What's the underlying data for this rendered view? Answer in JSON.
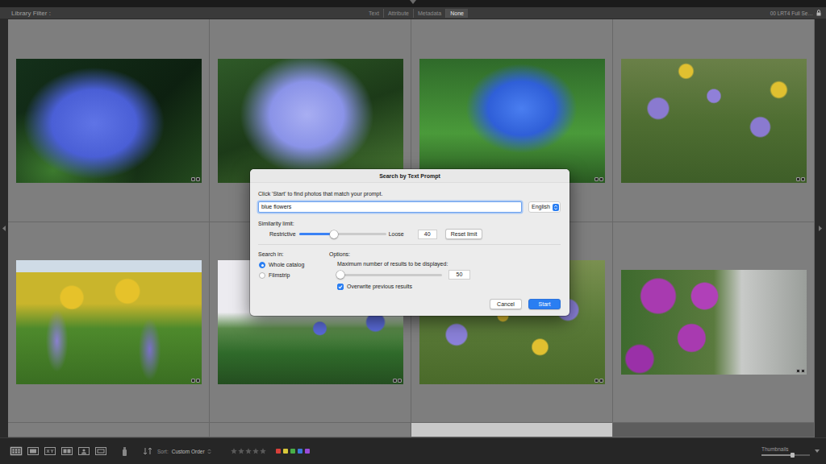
{
  "filter_bar": {
    "title": "Library Filter :",
    "tabs": [
      {
        "label": "Text",
        "selected": false
      },
      {
        "label": "Attribute",
        "selected": false
      },
      {
        "label": "Metadata",
        "selected": false
      },
      {
        "label": "None",
        "selected": true
      }
    ],
    "preset": "00 LRT4 Full Se…"
  },
  "grid": {
    "cells": [
      {
        "kind": "photo",
        "selected": false
      },
      {
        "kind": "photo",
        "selected": false
      },
      {
        "kind": "photo",
        "selected": false
      },
      {
        "kind": "photo",
        "selected": false
      },
      {
        "kind": "photo",
        "selected": false
      },
      {
        "kind": "photo",
        "selected": false
      },
      {
        "kind": "photo",
        "selected": false
      },
      {
        "kind": "photo",
        "selected": false
      },
      {
        "kind": "partial",
        "selected": false
      },
      {
        "kind": "partial",
        "selected": false
      },
      {
        "kind": "partial",
        "selected": true
      },
      {
        "kind": "empty",
        "selected": false
      }
    ]
  },
  "dialog": {
    "title": "Search by Text Prompt",
    "instruction": "Click 'Start' to find photos that match your prompt.",
    "prompt": "blue flowers",
    "language": "English",
    "similarity": {
      "label": "Similarity limit:",
      "min_label": "Restrictive",
      "max_label": "Loose",
      "level": 0.4,
      "value": "40",
      "reset": "Reset limit"
    },
    "search_in": {
      "label": "Search in:",
      "options": [
        {
          "label": "Whole catalog",
          "selected": true
        },
        {
          "label": "Filmstrip",
          "selected": false
        }
      ]
    },
    "options": {
      "label": "Options:",
      "max_results": {
        "label": "Maximum number of results to be displayed:",
        "level": 0.03,
        "value": "50"
      },
      "overwrite": {
        "label": "Overwrite previous results",
        "checked": true
      }
    },
    "buttons": [
      {
        "label": "Cancel",
        "primary": false
      },
      {
        "label": "Start",
        "primary": true
      }
    ]
  },
  "toolbar": {
    "view_modes": [
      {
        "selected": true
      },
      {
        "selected": false
      },
      {
        "selected": false
      },
      {
        "selected": false
      },
      {
        "selected": false
      },
      {
        "selected": false
      }
    ],
    "sort": {
      "label": "Sort:",
      "value": "Custom Order"
    },
    "rating": {
      "stars": 0
    },
    "color_labels": [
      {
        "color": "#d8403a"
      },
      {
        "color": "#d8c83a"
      },
      {
        "color": "#48ae48"
      },
      {
        "color": "#3a78d8"
      },
      {
        "color": "#9a4ad8"
      }
    ],
    "thumbnails": {
      "label": "Thumbnails",
      "level": 0.63
    }
  }
}
